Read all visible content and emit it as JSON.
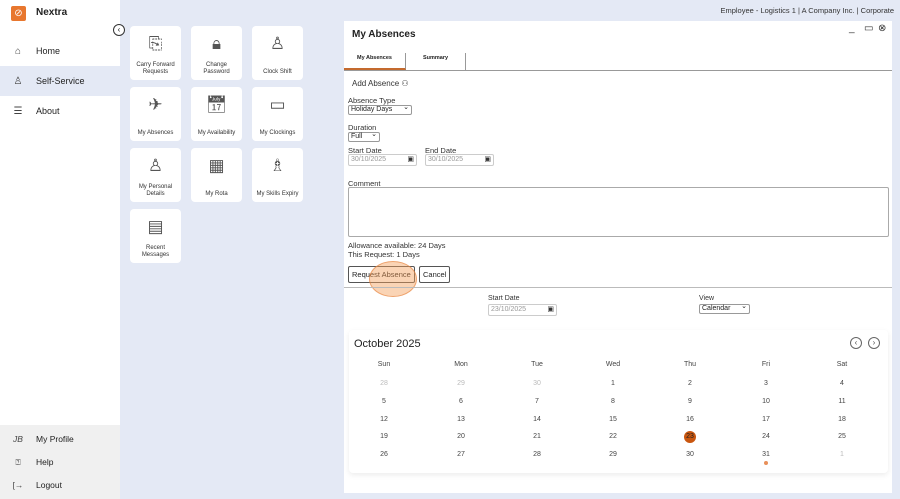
{
  "app": {
    "name": "Nextra",
    "logo_icon": "nextra-logo",
    "accent": "#e8772e"
  },
  "sidebar": {
    "items": [
      {
        "label": "Home",
        "icon": "home-icon"
      },
      {
        "label": "Self-Service",
        "icon": "user-icon",
        "active": true
      },
      {
        "label": "About",
        "icon": "menu-icon"
      }
    ],
    "bottom": [
      {
        "label": "My Profile",
        "icon_text": "JB"
      },
      {
        "label": "Help",
        "icon": "help-icon"
      },
      {
        "label": "Logout",
        "icon": "logout-icon"
      }
    ]
  },
  "context": "Employee - Logistics 1 | A Company Inc. | Corporate",
  "tiles": [
    {
      "label": "Carry Forward Requests",
      "icon": "carry-forward-icon"
    },
    {
      "label": "Change Password",
      "icon": "lock-icon"
    },
    {
      "label": "Clock Shift",
      "icon": "user-clock-icon"
    },
    {
      "label": "My Absences",
      "icon": "plane-icon"
    },
    {
      "label": "My Availability",
      "icon": "calendar-clock-icon"
    },
    {
      "label": "My Clockings",
      "icon": "calendar-icon"
    },
    {
      "label": "My Personal Details",
      "icon": "person-icon"
    },
    {
      "label": "My Rota",
      "icon": "grid-calendar-icon"
    },
    {
      "label": "My Skills Expiry",
      "icon": "graduate-icon"
    },
    {
      "label": "Recent Messages",
      "icon": "message-icon"
    }
  ],
  "panel": {
    "title": "My Absences",
    "tabs": [
      "My Absences",
      "Summary"
    ],
    "form": {
      "add_absence": "Add Absence",
      "absence_type_label": "Absence Type",
      "absence_type": "Holiday Days",
      "duration_label": "Duration",
      "duration": "Full",
      "start_date_label": "Start Date",
      "start_date": "30/10/2025",
      "end_date_label": "End Date",
      "end_date": "30/10/2025",
      "comment_label": "Comment",
      "comment": "",
      "allowance": "Allowance available: 24 Days",
      "this_request": "This Request: 1 Days",
      "request_button": "Request Absence",
      "cancel_button": "Cancel"
    },
    "filter": {
      "start_date_label": "Start Date",
      "start_date": "23/10/2025",
      "view_label": "View",
      "view": "Calendar"
    },
    "calendar": {
      "month": "October 2025",
      "weekdays": [
        "Sun",
        "Mon",
        "Tue",
        "Wed",
        "Thu",
        "Fri",
        "Sat"
      ],
      "weeks": [
        [
          "28",
          "29",
          "30",
          "1",
          "2",
          "3",
          "4"
        ],
        [
          "5",
          "6",
          "7",
          "8",
          "9",
          "10",
          "11"
        ],
        [
          "12",
          "13",
          "14",
          "15",
          "16",
          "17",
          "18"
        ],
        [
          "19",
          "20",
          "21",
          "22",
          "23",
          "24",
          "25"
        ],
        [
          "26",
          "27",
          "28",
          "29",
          "30",
          "31",
          "1"
        ]
      ],
      "selected": "23",
      "marked": "31",
      "selected_color": "#c9560f"
    }
  }
}
